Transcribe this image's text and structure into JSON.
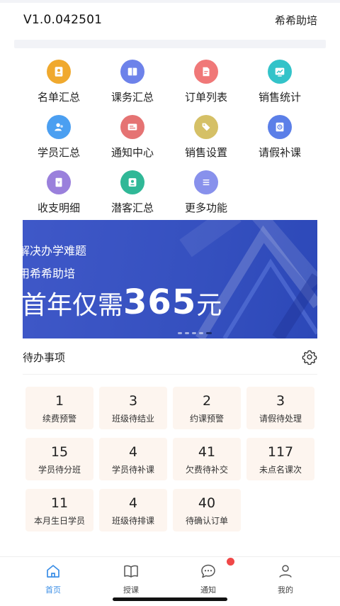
{
  "header": {
    "version": "V1.0.042501",
    "brand": "希希助培"
  },
  "grid": [
    {
      "label": "名单汇总",
      "icon": "contact-list-icon",
      "color": "#f0a92e"
    },
    {
      "label": "课务汇总",
      "icon": "book-icon",
      "color": "#6d82ea"
    },
    {
      "label": "订单列表",
      "icon": "order-doc-icon",
      "color": "#f07878"
    },
    {
      "label": "销售统计",
      "icon": "chart-icon",
      "color": "#33c3c9"
    },
    {
      "label": "学员汇总",
      "icon": "students-icon",
      "color": "#4b9ff1"
    },
    {
      "label": "通知中心",
      "icon": "notification-icon",
      "color": "#e57373"
    },
    {
      "label": "销售设置",
      "icon": "tag-icon",
      "color": "#d5c066"
    },
    {
      "label": "请假补课",
      "icon": "leave-clock-icon",
      "color": "#5b7fe8"
    },
    {
      "label": "收支明细",
      "icon": "ledger-icon",
      "color": "#9a80dc"
    },
    {
      "label": "潜客汇总",
      "icon": "prospect-icon",
      "color": "#30b897"
    },
    {
      "label": "更多功能",
      "icon": "more-menu-icon",
      "color": "#8891ec"
    }
  ],
  "banner": {
    "line1": "解决办学难题",
    "line2": "用希希助培",
    "line3_pre": "首年仅需",
    "line3_num": "365",
    "line3_post": "元",
    "slides": 5,
    "active_slide": 5
  },
  "todo": {
    "title": "待办事项",
    "items": [
      {
        "count": "1",
        "label": "续费预警"
      },
      {
        "count": "3",
        "label": "班级待结业"
      },
      {
        "count": "2",
        "label": "约课预警"
      },
      {
        "count": "3",
        "label": "请假待处理"
      },
      {
        "count": "15",
        "label": "学员待分班"
      },
      {
        "count": "4",
        "label": "学员待补课"
      },
      {
        "count": "41",
        "label": "欠费待补交"
      },
      {
        "count": "117",
        "label": "未点名课次"
      },
      {
        "count": "11",
        "label": "本月生日学员"
      },
      {
        "count": "4",
        "label": "班级待排课"
      },
      {
        "count": "40",
        "label": "待确认订单"
      }
    ]
  },
  "tabs": [
    {
      "label": "首页",
      "icon": "home-icon",
      "active": true
    },
    {
      "label": "授课",
      "icon": "open-book-icon",
      "active": false
    },
    {
      "label": "通知",
      "icon": "chat-bubble-icon",
      "active": false
    },
    {
      "label": "我的",
      "icon": "user-icon",
      "active": false
    }
  ],
  "colors": {
    "accent": "#3a8ee6",
    "badge": "#f04848",
    "card_bg": "#fdf5ef",
    "banner": "#3550bf"
  }
}
